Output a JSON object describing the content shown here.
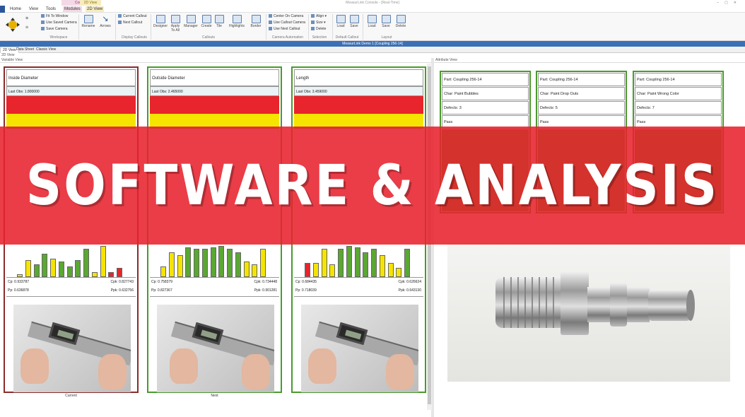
{
  "window": {
    "title": "MeasurLink Console - [Real-Time]",
    "context_tab_top": "Console",
    "context_tab_top2": "2D View"
  },
  "menu": {
    "items": [
      "Home",
      "View",
      "Tools",
      "Modules",
      "2D View"
    ]
  },
  "ribbon": {
    "workspace": {
      "fit": "Fit To Window",
      "use_saved": "Use Saved Camera",
      "save": "Save Camera",
      "group": "Workspace"
    },
    "rename": "Rename",
    "arrows": "Arrows",
    "callouts_display": {
      "current": "Current Callout",
      "next": "Next Callout",
      "group": "Display Callouts"
    },
    "designer": "Designer",
    "apply_to_all": "Apply To All",
    "manager": "Manager",
    "create": "Create",
    "tile": "Tile",
    "highlights": "Highlights",
    "border": "Border",
    "callouts_group": "Callouts",
    "camera": {
      "center": "Center On Camera",
      "use_callout": "Use Callout Camera",
      "use_next": "Use Next Callout",
      "group": "Camera Automation"
    },
    "selection": {
      "align": "Align",
      "size": "Size",
      "delete": "Delete",
      "group": "Selection"
    },
    "default_callout": {
      "load": "Load",
      "save": "Save",
      "group": "Default Callout"
    },
    "layout": {
      "load": "Load",
      "save": "Save",
      "delete": "Delete",
      "group": "Layout"
    }
  },
  "doc_title": "MeasurLink Demo 1 [Coupling 256-14]",
  "view_tabs": [
    "2D View",
    "Data Sheet",
    "Classic View"
  ],
  "sub_header": "2D View",
  "variable_view_label": "Variable View",
  "attribute_view_label": "Attribute View",
  "variable_panels": [
    {
      "name": "Inside Diameter",
      "last_obs": "Last Obs: 1.800000",
      "cp": "Cp: 0.933787",
      "cpk": "Cpk: 0.827743",
      "pp": "Pp: 0.636878",
      "ppk": "Ppk: 0.632756",
      "label": "Current",
      "border": "#8b2b2b",
      "hist": [
        {
          "v": 0.1,
          "c": "#f5e400"
        },
        {
          "v": 0.55,
          "c": "#f5e400"
        },
        {
          "v": 0.4,
          "c": "#5aa832"
        },
        {
          "v": 0.75,
          "c": "#5aa832"
        },
        {
          "v": 0.6,
          "c": "#f5e400"
        },
        {
          "v": 0.5,
          "c": "#5aa832"
        },
        {
          "v": 0.35,
          "c": "#5aa832"
        },
        {
          "v": 0.55,
          "c": "#5aa832"
        },
        {
          "v": 0.9,
          "c": "#5aa832"
        },
        {
          "v": 0.15,
          "c": "#f5e400"
        },
        {
          "v": 1.0,
          "c": "#f5e400"
        },
        {
          "v": 0.15,
          "c": "#e8242c"
        },
        {
          "v": 0.3,
          "c": "#e8242c"
        }
      ]
    },
    {
      "name": "Outside Diameter",
      "last_obs": "Last Obs: 2.465000",
      "cp": "Cp: 0.758379",
      "cpk": "Cpk: 0.734448",
      "pp": "Pp: 0.827367",
      "ppk": "Ppk: 0.901281",
      "label": "Next",
      "border": "#4a9a2c",
      "hist": [
        {
          "v": 0.35,
          "c": "#f5e400"
        },
        {
          "v": 0.8,
          "c": "#f5e400"
        },
        {
          "v": 0.7,
          "c": "#f5e400"
        },
        {
          "v": 0.95,
          "c": "#5aa832"
        },
        {
          "v": 0.9,
          "c": "#5aa832"
        },
        {
          "v": 0.9,
          "c": "#5aa832"
        },
        {
          "v": 0.95,
          "c": "#5aa832"
        },
        {
          "v": 1.0,
          "c": "#5aa832"
        },
        {
          "v": 0.9,
          "c": "#5aa832"
        },
        {
          "v": 0.8,
          "c": "#5aa832"
        },
        {
          "v": 0.5,
          "c": "#f5e400"
        },
        {
          "v": 0.4,
          "c": "#f5e400"
        },
        {
          "v": 0.9,
          "c": "#f5e400"
        }
      ]
    },
    {
      "name": "Length",
      "last_obs": "Last Obs: 3.459000",
      "cp": "Cp: 0.684435",
      "cpk": "Cpk: 0.626624",
      "pp": "Pp: 0.718039",
      "ppk": "Ppk: 0.643130",
      "label": "",
      "border": "#4a9a2c",
      "hist": [
        {
          "v": 0.45,
          "c": "#e8242c"
        },
        {
          "v": 0.45,
          "c": "#f5e400"
        },
        {
          "v": 0.9,
          "c": "#f5e400"
        },
        {
          "v": 0.4,
          "c": "#f5e400"
        },
        {
          "v": 0.9,
          "c": "#5aa832"
        },
        {
          "v": 1.0,
          "c": "#5aa832"
        },
        {
          "v": 0.95,
          "c": "#5aa832"
        },
        {
          "v": 0.8,
          "c": "#5aa832"
        },
        {
          "v": 0.9,
          "c": "#5aa832"
        },
        {
          "v": 0.7,
          "c": "#f5e400"
        },
        {
          "v": 0.45,
          "c": "#f5e400"
        },
        {
          "v": 0.3,
          "c": "#f5e400"
        },
        {
          "v": 0.9,
          "c": "#5aa832"
        }
      ]
    }
  ],
  "attribute_cards": [
    {
      "part": "Part: Coupling 256-14",
      "char": "Char: Paint Bubbles",
      "defects": "Defects: 3",
      "status": "Pass"
    },
    {
      "part": "Part: Coupling 256-14",
      "char": "Char: Paint Drop Outs",
      "defects": "Defects: 5",
      "status": "Pass"
    },
    {
      "part": "Part: Coupling 256-14",
      "char": "Char: Paint Wrong Color",
      "defects": "Defects: 7",
      "status": "Pass"
    }
  ],
  "banner": "SOFTWARE & ANALYSIS",
  "colors": {
    "accent": "#2b579a",
    "banner": "#e7222d",
    "out_of_spec": "#e8242c",
    "warning": "#f5e400",
    "ok": "#5aa832"
  }
}
